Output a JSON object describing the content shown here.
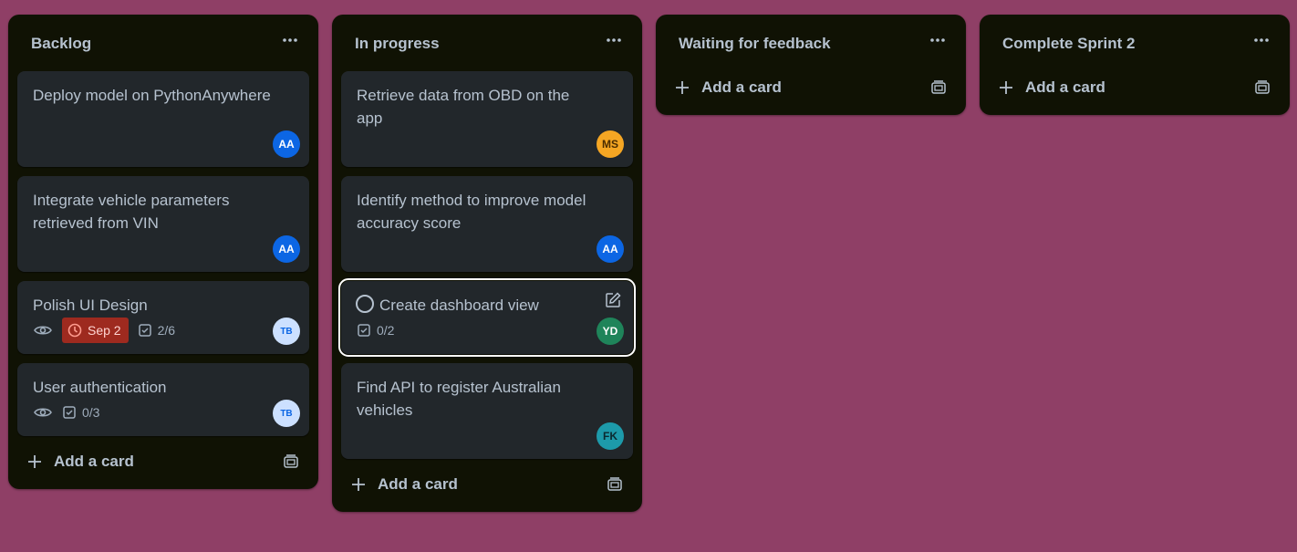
{
  "colors": {
    "board_background": "#8f3f66",
    "list_background": "#101204",
    "card_background": "#22272b",
    "text": "#b6c2cf",
    "due_overdue": "#9e2a1f"
  },
  "lists": [
    {
      "title": "Backlog",
      "add_card_label": "Add a card",
      "cards": [
        {
          "title": "Deploy model on PythonAnywhere",
          "member": "AA"
        },
        {
          "title": "Integrate vehicle parameters retrieved from VIN",
          "member": "AA"
        },
        {
          "title": "Polish UI Design",
          "due": "Sep 2",
          "checklist": "2/6",
          "member": "TB",
          "watching": true
        },
        {
          "title": "User authentication",
          "checklist": "0/3",
          "member": "TB",
          "watching": true
        }
      ]
    },
    {
      "title": "In progress",
      "add_card_label": "Add a card",
      "cards": [
        {
          "title": "Retrieve data from OBD on the app",
          "member": "MS"
        },
        {
          "title": "Identify method to improve model accuracy score",
          "member": "AA"
        },
        {
          "title": "Create dashboard view",
          "checklist": "0/2",
          "member": "YD",
          "selected": true
        },
        {
          "title": "Find API to register Australian vehicles",
          "member": "FK"
        }
      ]
    },
    {
      "title": "Waiting for feedback",
      "add_card_label": "Add a card",
      "cards": []
    },
    {
      "title": "Complete Sprint 2",
      "add_card_label": "Add a card",
      "cards": []
    }
  ]
}
